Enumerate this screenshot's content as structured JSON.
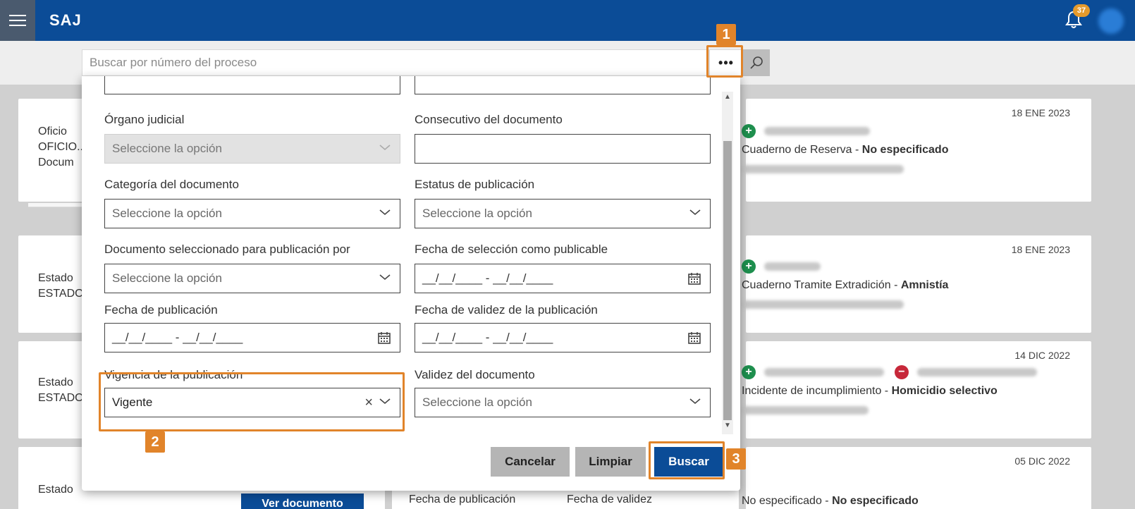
{
  "topbar": {
    "brand": "SAJ",
    "notification_count": "37"
  },
  "search": {
    "placeholder": "Buscar por número del proceso",
    "more_label": "•••"
  },
  "cards": [
    {
      "left_lines": [
        "Oficio",
        "OFICIO...",
        "Docum"
      ],
      "date": "18 ENE 2023",
      "case_prefix": "Cuaderno de Reserva - ",
      "case_bold": "No especificado"
    },
    {
      "left_lines": [
        "Estado",
        "ESTADO"
      ],
      "date": "18 ENE 2023",
      "case_prefix": "Cuaderno Tramite Extradición - ",
      "case_bold": "Amnistía"
    },
    {
      "left_lines": [
        "Estado",
        "ESTADO"
      ],
      "date": "14 DIC 2022",
      "case_prefix": "Incidente de incumplimiento - ",
      "case_bold": "Homicidio selectivo"
    },
    {
      "left_lines": [
        "Estado"
      ],
      "date": "05 DIC 2022",
      "case_prefix": "No especificado - ",
      "case_bold": "No especificado",
      "button": "Ver documento",
      "mid_label_1": "Fecha de publicación",
      "mid_label_2": "Fecha de validez"
    }
  ],
  "form": {
    "organo_label": "Órgano judicial",
    "organo_value": "Seleccione la opción",
    "consecutivo_label": "Consecutivo del documento",
    "consecutivo_value": "",
    "categoria_label": "Categoría del documento",
    "categoria_value": "Seleccione la opción",
    "estatus_label": "Estatus de publicación",
    "estatus_value": "Seleccione la opción",
    "seleccionado_label": "Documento seleccionado para publicación por",
    "seleccionado_value": "Seleccione la opción",
    "fecha_seleccion_label": "Fecha de selección como publicable",
    "fecha_seleccion_value": "__/__/____ - __/__/____",
    "fecha_publicacion_label": "Fecha de publicación",
    "fecha_publicacion_value": "__/__/____ - __/__/____",
    "fecha_validez_label": "Fecha de validez de la publicación",
    "fecha_validez_value": "__/__/____ - __/__/____",
    "vigencia_label": "Vigencia de la publicación",
    "vigencia_value": "Vigente",
    "validez_label": "Validez del documento",
    "validez_value": "Seleccione la opción",
    "cancel_label": "Cancelar",
    "clear_label": "Limpiar",
    "search_label": "Buscar"
  },
  "annotations": {
    "step1": "1",
    "step2": "2",
    "step3": "3"
  },
  "colors": {
    "primary": "#0b4c97",
    "highlight": "#e1842a",
    "add_green": "#1e8f4e",
    "remove_red": "#c7283a"
  }
}
